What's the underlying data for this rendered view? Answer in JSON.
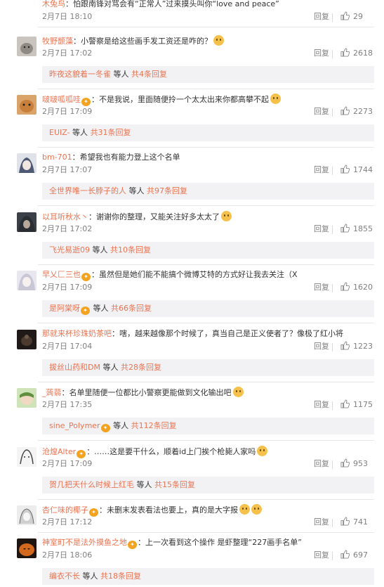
{
  "top": {
    "user": "木兔鸟",
    "text": "：怕跟南锋对骂会有“正常人”过来摸头叫你“love and peace”",
    "date": "2月7日 18:10",
    "reply": "回复",
    "likes": "29"
  },
  "comments": [
    {
      "avatar": "cat",
      "user": "牧野颤藻",
      "vip": false,
      "text": "：小警察是给这些画手发工资还是咋的？",
      "emojis": 1,
      "date": "2月7日 17:02",
      "reply": "回复",
      "likes": "2618",
      "sub_user": "昨夜这貌着一冬雀",
      "sub_more": " 等人 ",
      "sub_count": "共4条回复"
    },
    {
      "avatar": "orange-cat",
      "user": "啵啵呱呱哇",
      "vip": true,
      "text": "：不是我说，里面随便拎一个太太出来你都高攀不起",
      "emojis": 1,
      "date": "2月7日 17:09",
      "reply": "回复",
      "likes": "2273",
      "sub_user": "EUIZ-",
      "sub_more": " 等人 ",
      "sub_count": "共31条回复"
    },
    {
      "avatar": "anime-gray",
      "user": "bm-701",
      "vip": false,
      "text": "：希望我也有能力登上这个名单",
      "emojis": 0,
      "date": "2月7日 17:07",
      "reply": "回复",
      "likes": "1744",
      "sub_user": "全世界唯一长脖子的人",
      "sub_more": " 等人 ",
      "sub_count": "共97条回复"
    },
    {
      "avatar": "anime-dark",
      "user": "以耳听秋水丶",
      "vip": false,
      "text": "：谢谢你的整理，又能关注好多太太了",
      "emojis": 1,
      "date": "2月7日 17:02",
      "reply": "回复",
      "likes": "1855",
      "sub_user": "飞光易逝09",
      "sub_more": " 等人 ",
      "sub_count": "共10条回复"
    },
    {
      "avatar": "pale",
      "user": "早乂匚三也",
      "vip": true,
      "text": "：虽然但是她们能不能搞个微博艾特的方式好让我去关注（X",
      "emojis": 0,
      "date": "2月7日 17:09",
      "reply": "回复",
      "likes": "1620",
      "sub_user": "是阿棠呀",
      "sub_vip": true,
      "sub_more": " 等人 ",
      "sub_count": "共66条回复"
    },
    {
      "avatar": "dark-photo",
      "user": "那就来杯珍珠奶茶吧",
      "vip": false,
      "text": "：嗐，越来越像那个时候了，真当自己是正义使者了？像极了红小将",
      "emojis": 0,
      "date": "2月7日 17:04",
      "reply": "回复",
      "likes": "1223",
      "sub_user": "拔丝山药和DM",
      "sub_more": " 等人 ",
      "sub_count": "共28条回复"
    },
    {
      "avatar": "green",
      "user": "_蒟蒻",
      "vip": false,
      "text": "：名单里随便一位都比小警察更能做到文化输出吧",
      "emojis": 1,
      "date": "2月7日 17:35",
      "reply": "回复",
      "likes": "1175",
      "sub_user": "sine_Polymer",
      "sub_vip": true,
      "sub_more": " 等人 ",
      "sub_count": "共112条回复"
    },
    {
      "avatar": "sketch",
      "user": "沧煌Alter",
      "vip": true,
      "text": "：……这是要干什么，顺着id上门挨个枪毙人家吗",
      "emojis": 1,
      "date": "2月7日 17:09",
      "reply": "回复",
      "likes": "953",
      "sub_user": "贺几把天什么时候上红毛",
      "sub_more": " 等人 ",
      "sub_count": "共15条回复"
    },
    {
      "avatar": "sketch2",
      "user": "杏仁味的椰子",
      "vip": true,
      "text": "：未删末发表看法也要上，真的是大字报",
      "emojis": 2,
      "date": "2月7日 17:12",
      "reply": "回复",
      "likes": "741",
      "sub_user": "",
      "sub_more": "",
      "sub_count": ""
    },
    {
      "avatar": "pumpkin",
      "user": "神室町不是法外摸鱼之地",
      "vip": true,
      "text": "：上一次看到这个操作 是虾整理“227画手名单”",
      "emojis": 0,
      "date": "2月7日 18:06",
      "reply": "回复",
      "likes": "697",
      "sub_user": "编衣不长",
      "sub_more": " 等人 ",
      "sub_count": "共18条回复"
    }
  ],
  "icons": {
    "like": "thumbs-up-icon",
    "vip_badge": "vip-badge-icon",
    "emoji": "smiley-emoji-icon"
  },
  "colors": {
    "link": "#eb7350",
    "meta": "#808080",
    "subbox": "#f2f2f5"
  }
}
